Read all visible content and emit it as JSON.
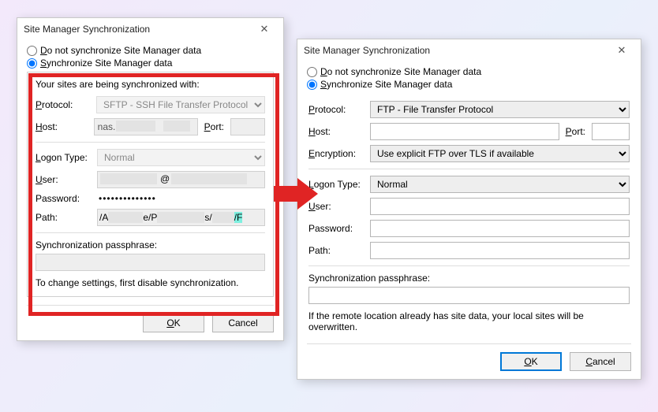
{
  "left": {
    "title": "Site Manager Synchronization",
    "radio_no_sync": "Do not synchronize Site Manager data",
    "radio_sync": "Synchronize Site Manager data",
    "sync_selected": true,
    "group_legend": "Your sites are being synchronized with:",
    "protocol_label": "Protocol:",
    "protocol_value": "SFTP - SSH File Transfer Protocol",
    "host_label": "Host:",
    "host_value_visible": "nas.",
    "port_label": "Port:",
    "port_value": "",
    "logon_label": "Logon Type:",
    "logon_value": "Normal",
    "user_label": "User:",
    "user_value_visible": "@",
    "password_label": "Password:",
    "password_dots": "••••••••••••••",
    "path_label": "Path:",
    "path_prefix": "/A",
    "path_mid": "e/P",
    "path_s": "s/",
    "path_hl": "/F",
    "passphrase_label": "Synchronization passphrase:",
    "passphrase_value": "",
    "footer_note": "To change settings, first disable synchronization.",
    "ok": "OK",
    "cancel": "Cancel"
  },
  "right": {
    "title": "Site Manager Synchronization",
    "radio_no_sync": "Do not synchronize Site Manager data",
    "radio_sync": "Synchronize Site Manager data",
    "sync_selected": true,
    "protocol_label": "Protocol:",
    "protocol_value": "FTP - File Transfer Protocol",
    "host_label": "Host:",
    "host_value": "",
    "port_label": "Port:",
    "port_value": "",
    "encryption_label": "Encryption:",
    "encryption_value": "Use explicit FTP over TLS if available",
    "logon_label": "Logon Type:",
    "logon_value": "Normal",
    "user_label": "User:",
    "user_value": "",
    "password_label": "Password:",
    "password_value": "",
    "path_label": "Path:",
    "path_value": "",
    "passphrase_label": "Synchronization passphrase:",
    "passphrase_value": "",
    "footer_note": "If the remote location already has site data, your local sites will be overwritten.",
    "ok": "OK",
    "cancel": "Cancel"
  }
}
